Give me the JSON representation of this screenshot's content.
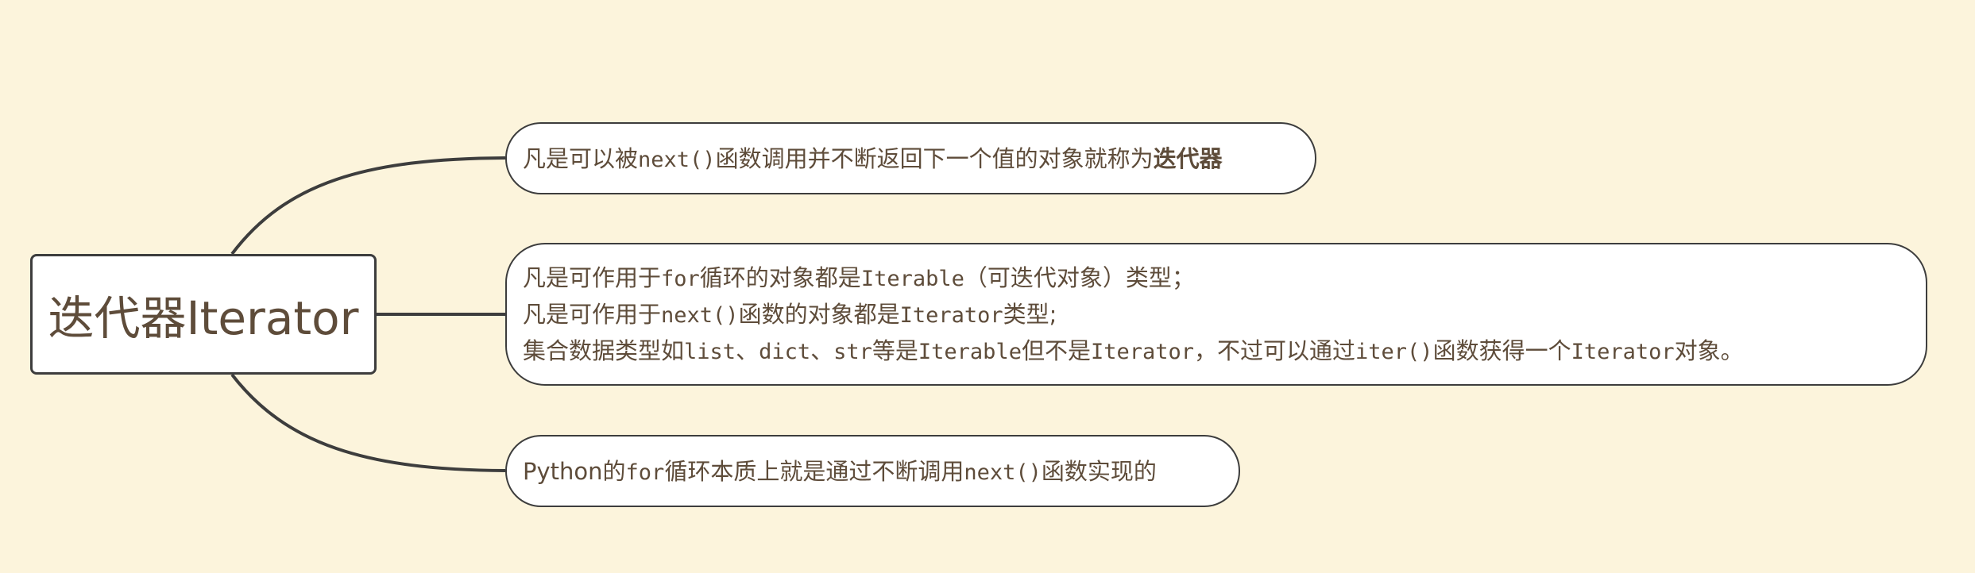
{
  "mindmap": {
    "root": {
      "label": "迭代器Iterator"
    },
    "branch_1": {
      "t1": "凡是可以被",
      "c1": "next()",
      "t2": "函数调用并不断返回下一个值的对象就称为",
      "b1": "迭代器"
    },
    "branch_2": {
      "line_1": {
        "t1": "凡是可作用于",
        "c1": "for",
        "t2": "循环的对象都是",
        "c2": "Iterable",
        "t3": "（可迭代对象）类型；"
      },
      "line_2": {
        "t1": "凡是可作用于",
        "c1": "next()",
        "t2": "函数的对象都是",
        "c2": "Iterator",
        "t3": "类型;"
      },
      "line_3": {
        "t1": "集合数据类型如",
        "c1": "list",
        "t2": "、",
        "c2": "dict",
        "t3": "、",
        "c3": "str",
        "t4": "等是",
        "c4": "Iterable",
        "t5": "但不是",
        "c5": "Iterator",
        "t6": "，不过可以通过",
        "c6": "iter()",
        "t7": "函数获得一个",
        "c7": "Iterator",
        "t8": "对象。"
      }
    },
    "branch_3": {
      "t1": "Python的",
      "c1": "for",
      "t2": "循环本质上就是通过不断调用",
      "c2": "next()",
      "t3": "函数实现的"
    }
  }
}
